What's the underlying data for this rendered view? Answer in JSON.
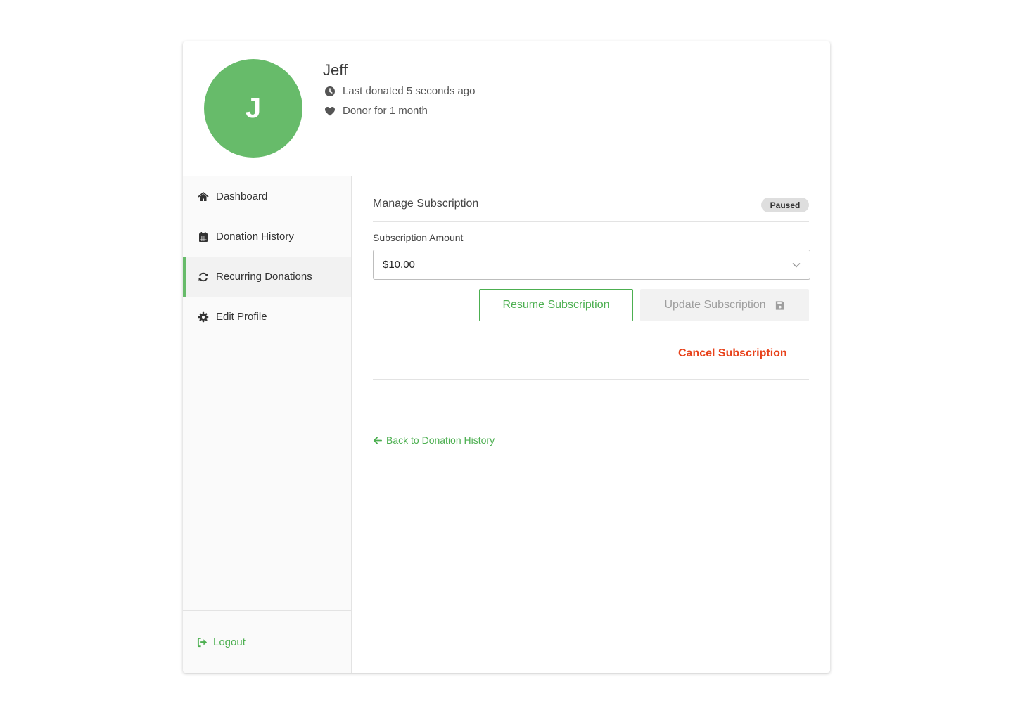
{
  "profile": {
    "initial": "J",
    "name": "Jeff",
    "last_donated": "Last donated 5 seconds ago",
    "donor_since": "Donor for 1 month",
    "avatar_color": "#67bb6a"
  },
  "sidebar": {
    "items": [
      {
        "label": "Dashboard",
        "icon": "home-icon",
        "active": false
      },
      {
        "label": "Donation History",
        "icon": "calendar-icon",
        "active": false
      },
      {
        "label": "Recurring Donations",
        "icon": "sync-icon",
        "active": true
      },
      {
        "label": "Edit Profile",
        "icon": "gear-icon",
        "active": false
      }
    ],
    "logout_label": "Logout"
  },
  "subscription": {
    "title": "Manage Subscription",
    "status": "Paused",
    "amount_label": "Subscription Amount",
    "amount_value": "$10.00",
    "resume_label": "Resume Subscription",
    "update_label": "Update Subscription",
    "cancel_label": "Cancel Subscription",
    "back_label": "Back to Donation History"
  },
  "colors": {
    "accent": "#4caf50",
    "danger": "#e8421b",
    "badge": "#dedede"
  }
}
